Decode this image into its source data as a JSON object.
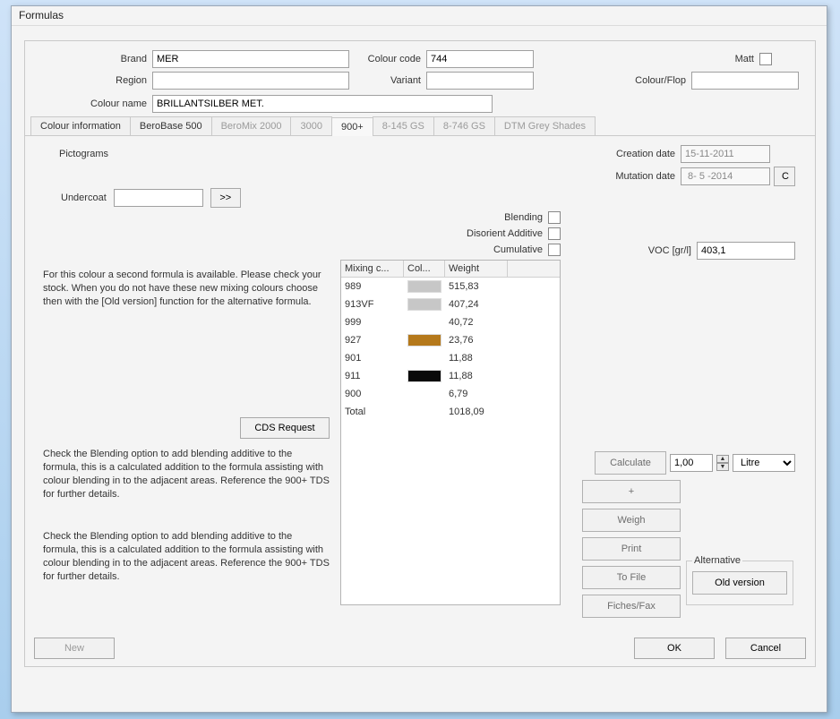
{
  "window_title": "Formulas",
  "top": {
    "brand_label": "Brand",
    "brand_value": "MER",
    "colourcode_label": "Colour code",
    "colourcode_value": "744",
    "matt_label": "Matt",
    "region_label": "Region",
    "region_value": "",
    "variant_label": "Variant",
    "variant_value": "",
    "colourflop_label": "Colour/Flop",
    "colourflop_value": "",
    "colourname_label": "Colour name",
    "colourname_value": "BRILLANTSILBER MET."
  },
  "tabs": [
    {
      "label": "Colour information",
      "state": "enabled"
    },
    {
      "label": "BeroBase 500",
      "state": "enabled"
    },
    {
      "label": "BeroMix 2000",
      "state": "disabled"
    },
    {
      "label": "3000",
      "state": "disabled"
    },
    {
      "label": "900+",
      "state": "active"
    },
    {
      "label": "8-145 GS",
      "state": "disabled"
    },
    {
      "label": "8-746 GS",
      "state": "disabled"
    },
    {
      "label": "DTM Grey Shades",
      "state": "disabled"
    }
  ],
  "panel": {
    "pictograms_label": "Pictograms",
    "undercoat_label": "Undercoat",
    "undercoat_value": "",
    "undercoat_btn": ">>",
    "creation_label": "Creation date",
    "creation_value": "15-11-2011",
    "mutation_label": "Mutation date",
    "mutation_value": " 8- 5 -2014",
    "mutation_c": "C",
    "blending_label": "Blending",
    "disorient_label": "Disorient Additive",
    "cumulative_label": "Cumulative",
    "voc_label": "VOC [gr/l]",
    "voc_value": "403,1",
    "cds_request": "CDS Request",
    "info1": "For this colour a second formula is available. Please check your stock. When you do not have these new mixing colours choose then with the [Old version] function for the alternative formula.",
    "info2": "Check the Blending option to add blending additive to the formula, this is a calculated addition to the formula assisting with colour blending in to the adjacent areas. Reference the 900+ TDS for further details.",
    "info3": "Check the Blending option to add blending additive to the formula, this is a calculated addition to the formula assisting with colour blending in to the adjacent areas. Reference the 900+ TDS for further details."
  },
  "grid": {
    "headers": {
      "code": "Mixing c...",
      "col": "Col...",
      "weight": "Weight"
    },
    "rows": [
      {
        "code": "989",
        "color": "#c7c7c7",
        "weight": "515,83"
      },
      {
        "code": "913VF",
        "color": "#c7c7c7",
        "weight": "407,24"
      },
      {
        "code": "999",
        "color": "",
        "weight": "40,72"
      },
      {
        "code": "927",
        "color": "#b5791b",
        "weight": "23,76"
      },
      {
        "code": "901",
        "color": "",
        "weight": "11,88"
      },
      {
        "code": "911",
        "color": "#0a0a0a",
        "weight": "11,88"
      },
      {
        "code": "900",
        "color": "",
        "weight": "6,79"
      }
    ],
    "total_label": "Total",
    "total_value": "1018,09"
  },
  "buttons": {
    "calculate": "Calculate",
    "plus": "+",
    "weigh": "Weigh",
    "print": "Print",
    "tofile": "To File",
    "fichesfax": "Fiches/Fax",
    "alternative_legend": "Alternative",
    "oldversion": "Old version",
    "amount_value": "1,00",
    "unit_value": "Litre"
  },
  "bottom": {
    "new": "New",
    "ok": "OK",
    "cancel": "Cancel"
  }
}
